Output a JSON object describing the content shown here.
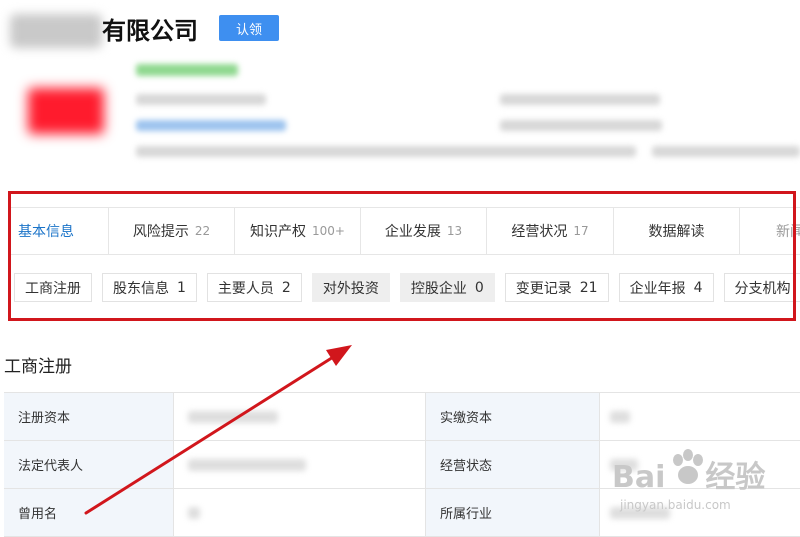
{
  "header": {
    "company_title": "有限公司",
    "claim_button": "认领"
  },
  "tabs": [
    {
      "label": "基本信息",
      "count": ""
    },
    {
      "label": "风险提示",
      "count": "22"
    },
    {
      "label": "知识产权",
      "count": "100+"
    },
    {
      "label": "企业发展",
      "count": "13"
    },
    {
      "label": "经营状况",
      "count": "17"
    },
    {
      "label": "数据解读",
      "count": ""
    },
    {
      "label": "新闻",
      "count": ""
    }
  ],
  "subtabs": [
    {
      "label": "工商注册",
      "count": ""
    },
    {
      "label": "股东信息",
      "count": "1"
    },
    {
      "label": "主要人员",
      "count": "2"
    },
    {
      "label": "对外投资",
      "count": ""
    },
    {
      "label": "控股企业",
      "count": "0"
    },
    {
      "label": "变更记录",
      "count": "21"
    },
    {
      "label": "企业年报",
      "count": "4"
    },
    {
      "label": "分支机构",
      "count": ""
    }
  ],
  "section": {
    "title": "工商注册",
    "rows": [
      {
        "label1": "注册资本",
        "label2": "实缴资本"
      },
      {
        "label1": "法定代表人",
        "label2": "经营状态"
      },
      {
        "label1": "曾用名",
        "label2": "所属行业"
      }
    ]
  },
  "watermark": {
    "brand": "Bai",
    "brand2": "经验",
    "url": "jingyan.baidu.com"
  },
  "colors": {
    "accent": "#1a73c8",
    "button": "#3e8ff0",
    "highlight": "#d1161c"
  }
}
